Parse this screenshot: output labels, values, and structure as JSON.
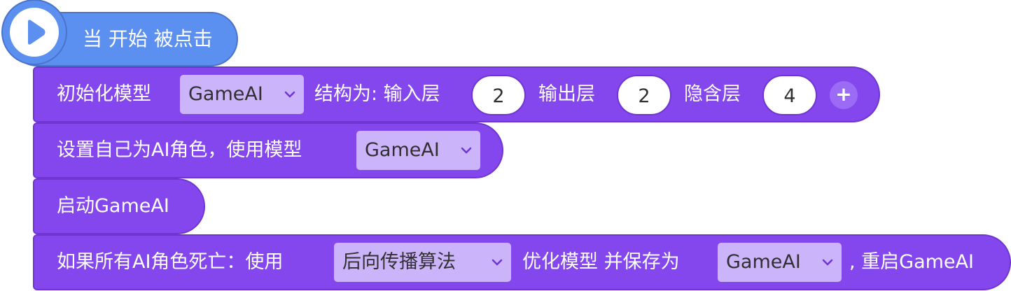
{
  "hat": {
    "label": "当 开始 被点击",
    "icon": "play-icon"
  },
  "block1": {
    "label": "初始化模型",
    "model_dropdown": "GameAI",
    "structure_label": "结构为: 输入层",
    "input_layers": "2",
    "output_label": "输出层",
    "output_layers": "2",
    "hidden_label": "隐含层",
    "hidden_layers": "4",
    "add_label": "+"
  },
  "block2": {
    "label": "设置自己为AI角色，使用模型",
    "model_dropdown": "GameAI"
  },
  "block3": {
    "label": "启动GameAI"
  },
  "block4": {
    "label": "如果所有AI角色死亡：使用",
    "algorithm_dropdown": "后向传播算法",
    "optimize_label": "优化模型 并保存为",
    "model_dropdown": "GameAI",
    "suffix": ", 重启GameAI"
  },
  "colors": {
    "hat": "#5b8ff0",
    "block": "#8447ee",
    "dropdown": "#cbb4fa"
  }
}
